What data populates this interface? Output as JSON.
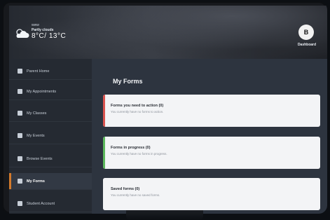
{
  "brand": {
    "tiny": "www",
    "name": "Partly clouds",
    "temp": "8°C/ 13°C",
    "icon": "cloud-sun-icon"
  },
  "header": {
    "avatar_initials": "B",
    "dashboard_label": "Dashboard"
  },
  "sidebar": {
    "items": [
      {
        "label": "Parent Home",
        "icon": "home-icon"
      },
      {
        "label": "My Appointments",
        "icon": "calendar-icon"
      },
      {
        "label": "My Classes",
        "icon": "class-icon"
      },
      {
        "label": "My Events",
        "icon": "event-icon"
      },
      {
        "label": "Browse Events",
        "icon": "browse-icon"
      },
      {
        "label": "My Forms",
        "icon": "forms-icon",
        "active": true
      },
      {
        "label": "Student Account",
        "icon": "account-icon"
      }
    ]
  },
  "main": {
    "title": "My Forms",
    "cards": [
      {
        "title": "Forms you need to action (0)",
        "subtitle": "You currently have no forms to action.",
        "accent": "#d9534f"
      },
      {
        "title": "Forms in progress (0)",
        "subtitle": "You currently have no forms in progress.",
        "accent": "#5cb85c"
      },
      {
        "title": "Saved forms (0)",
        "subtitle": "You currently have no saved forms.",
        "accent": "#f3f4f6"
      }
    ]
  },
  "colors": {
    "sidebar_bg": "#252a32",
    "main_bg": "#2d343f",
    "active_accent": "#d37a2c"
  }
}
